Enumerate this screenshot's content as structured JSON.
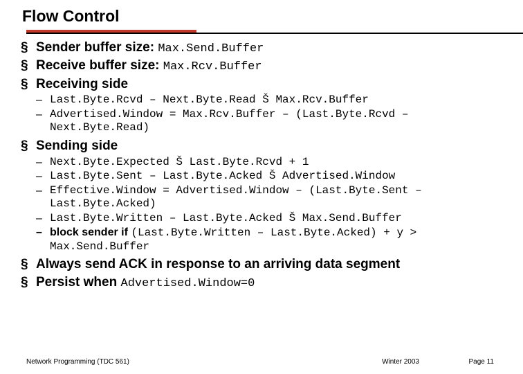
{
  "title": "Flow Control",
  "bullets": {
    "b1": {
      "label": "Sender buffer size: ",
      "code": "Max.Send.Buffer"
    },
    "b2": {
      "label": "Receive buffer size: ",
      "code": "Max.Rcv.Buffer"
    },
    "b3": {
      "label": "Receiving side",
      "sub": [
        "Last.Byte.Rcvd – Next.Byte.Read Š Max.Rcv.Buffer",
        "Advertised.Window = Max.Rcv.Buffer – (Last.Byte.Rcvd – Next.Byte.Read)"
      ]
    },
    "b4": {
      "label": "Sending side",
      "sub": [
        "Next.Byte.Expected Š Last.Byte.Rcvd + 1",
        "Last.Byte.Sent – Last.Byte.Acked Š Advertised.Window",
        "Effective.Window = Advertised.Window – (Last.Byte.Sent – Last.Byte.Acked)",
        "Last.Byte.Written – Last.Byte.Acked Š Max.Send.Buffer"
      ],
      "block": {
        "label": "block sender if ",
        "code1": "(Last.Byte.Written – Last.Byte.Acked) + y  >",
        "code2": "Max.Send.Buffer"
      }
    },
    "b5": {
      "label": "Always send ACK in response to an arriving data segment"
    },
    "b6": {
      "label": "Persist when ",
      "code": "Advertised.Window=0"
    }
  },
  "footer": {
    "left": "Network Programming (TDC 561)",
    "mid": "Winter  2003",
    "right": "Page 11"
  }
}
